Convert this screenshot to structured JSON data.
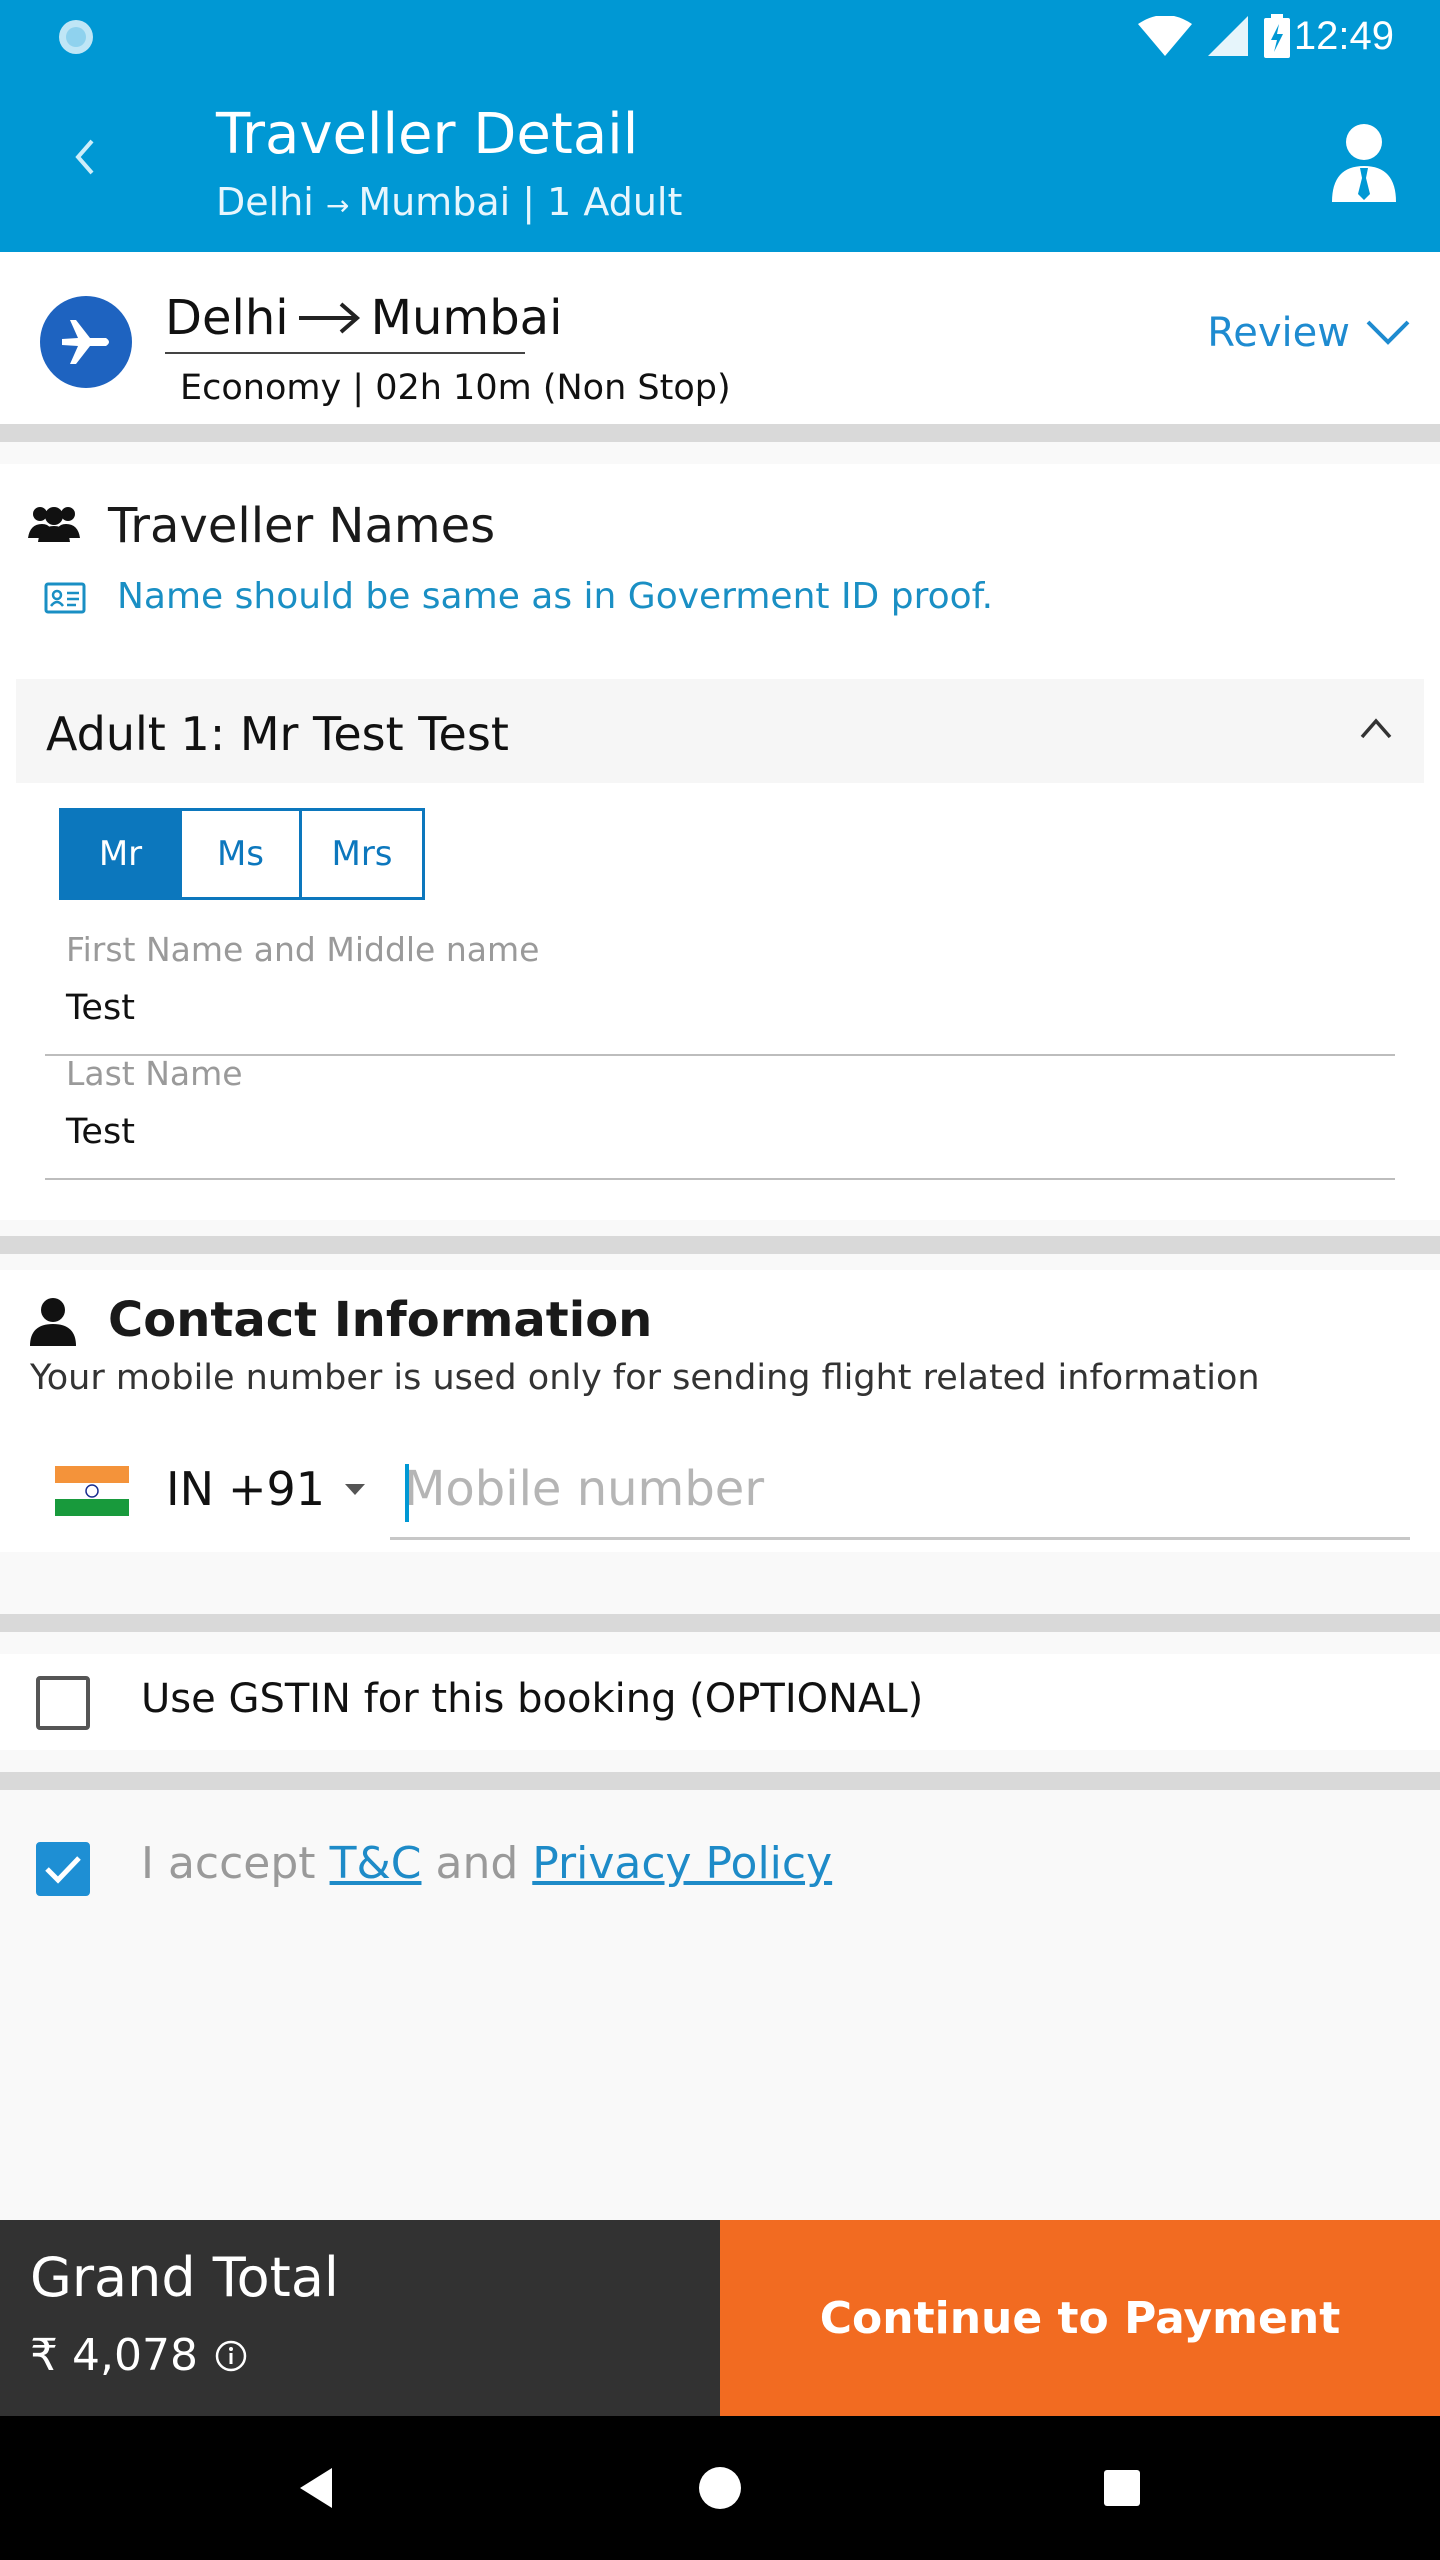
{
  "status_bar": {
    "time": "12:49"
  },
  "app_bar": {
    "title": "Traveller Detail",
    "subtitle_from": "Delhi",
    "subtitle_to": "Mumbai | 1 Adult"
  },
  "flight": {
    "from": "Delhi",
    "to": "Mumbai",
    "meta": "Economy | 02h 10m (Non Stop)",
    "review_label": "Review"
  },
  "traveller_names": {
    "title": "Traveller Names",
    "note": "Name should be same as in Goverment ID proof.",
    "adult_label": "Adult 1: Mr Test Test",
    "titles": [
      "Mr",
      "Ms",
      "Mrs"
    ],
    "selected_title": "Mr",
    "first_name_label": "First Name and Middle name",
    "first_name_value": "Test",
    "last_name_label": "Last Name",
    "last_name_value": "Test"
  },
  "contact": {
    "title": "Contact Information",
    "subtitle": "Your mobile number is used only for sending flight related information",
    "country_code": "IN",
    "dial_code": "+91",
    "mobile_placeholder": "Mobile number"
  },
  "gstin": {
    "label": "Use GSTIN for this booking (OPTIONAL)",
    "checked": false
  },
  "terms": {
    "prefix": "I accept",
    "tc_link": "T&C",
    "and": "and",
    "privacy_link": "Privacy Policy",
    "checked": true
  },
  "bottom": {
    "total_label": "Grand Total",
    "total_value": "₹ 4,078",
    "pay_label": "Continue to Payment"
  },
  "colors": {
    "primary": "#0098d4",
    "accent_orange": "#f26b21",
    "dark_panel": "#323232",
    "link_blue": "#1e8bc8"
  }
}
